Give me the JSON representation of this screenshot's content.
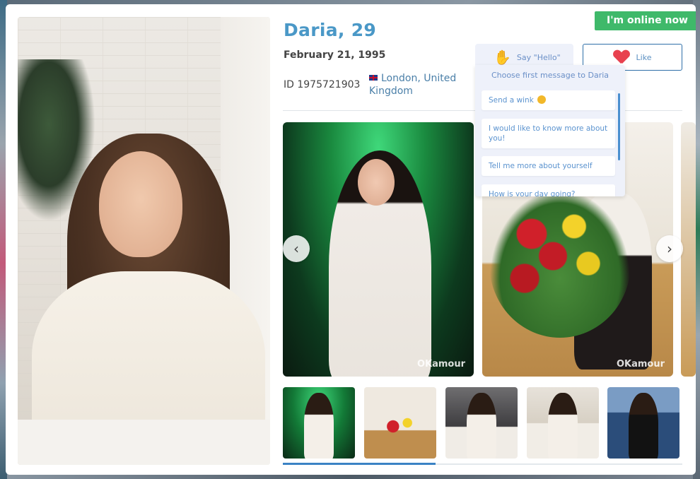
{
  "profile": {
    "name_age": "Daria, 29",
    "birthdate": "February 21, 1995",
    "id_label": "ID 1975721903",
    "location": "London, United Kingdom"
  },
  "status": {
    "online_label": "I'm online now"
  },
  "actions": {
    "say_hello_label": "Say \"Hello\"",
    "like_label": "Like"
  },
  "first_message": {
    "header": "Choose first message to Daria",
    "options": [
      "Send a wink",
      "I would like to know more about you!",
      "Tell me more about yourself",
      "How is your day going?"
    ]
  },
  "gallery": {
    "watermark": "OKamour",
    "thumbnail_count": 5,
    "progress_fraction": 0.38
  },
  "colors": {
    "accent_blue": "#4a98c7",
    "online_green": "#3fb96a",
    "like_red": "#e8414f",
    "panel_bg": "#eef1fa"
  }
}
